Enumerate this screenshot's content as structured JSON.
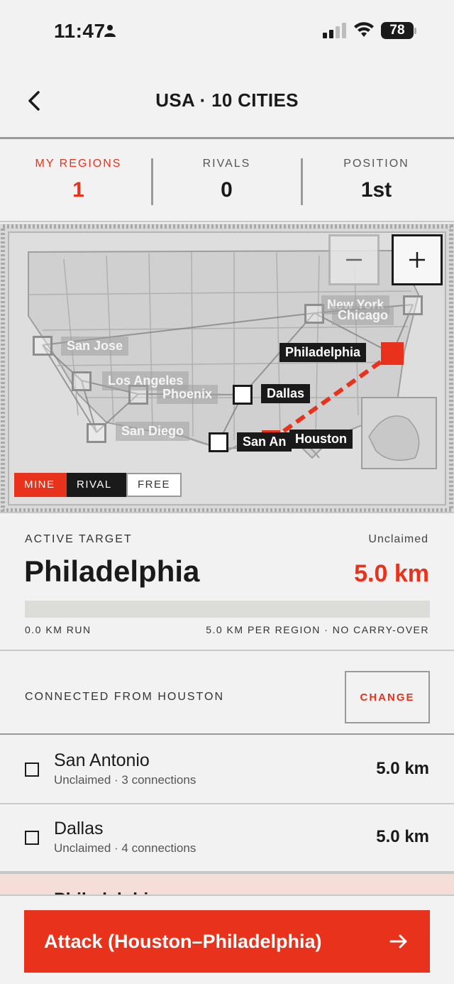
{
  "status_bar": {
    "time": "11:47",
    "battery": "78"
  },
  "header": {
    "title": "USA · 10 CITIES"
  },
  "stats": [
    {
      "label": "MY REGIONS",
      "value": "1"
    },
    {
      "label": "RIVALS",
      "value": "0"
    },
    {
      "label": "POSITION",
      "value": "1st"
    }
  ],
  "map": {
    "cities": {
      "new_york": "New York",
      "chicago": "Chicago",
      "san_jose": "San Jose",
      "philadelphia": "Philadelphia",
      "los_angeles": "Los Angeles",
      "phoenix": "Phoenix",
      "dallas": "Dallas",
      "san_diego": "San Diego",
      "san_antonio": "San An",
      "houston": "Houston"
    },
    "legend": {
      "mine": "MINE",
      "rival": "RIVAL",
      "free": "FREE"
    }
  },
  "active_target": {
    "label": "ACTIVE TARGET",
    "status": "Unclaimed",
    "city": "Philadelphia",
    "distance": "5.0 km",
    "progress_fraction": 0,
    "run": "0.0 KM RUN",
    "rule": "5.0 KM PER REGION · NO CARRY-OVER"
  },
  "connected": {
    "label": "CONNECTED FROM HOUSTON",
    "change": "CHANGE"
  },
  "list": [
    {
      "name": "San Antonio",
      "sub": "Unclaimed · 3 connections",
      "km": "5.0 km"
    },
    {
      "name": "Dallas",
      "sub": "Unclaimed · 4 connections",
      "km": "5.0 km"
    },
    {
      "name": "Philadelphia"
    }
  ],
  "cta": {
    "label": "Attack (Houston–Philadelphia)"
  },
  "colors": {
    "accent": "#e8321c",
    "dark": "#1a1a1a",
    "background": "#f2f2f2"
  }
}
